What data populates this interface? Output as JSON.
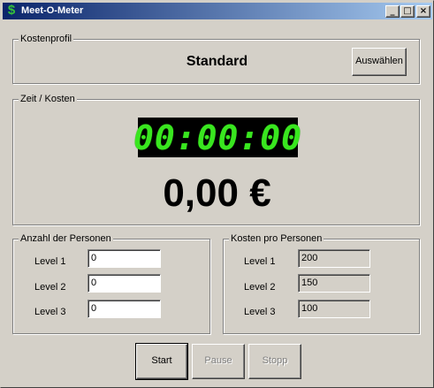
{
  "window": {
    "title": "Meet-O-Meter",
    "icon": "dollar-icon",
    "controls": {
      "minimize": "_",
      "maximize": "□",
      "close": "×"
    }
  },
  "profile": {
    "group_label": "Kostenprofil",
    "name": "Standard",
    "select_button": "Auswählen"
  },
  "time_cost": {
    "group_label": "Zeit / Kosten",
    "timer": "00:00:00",
    "cost": "0,00 €"
  },
  "persons": {
    "group_label": "Anzahl der Personen",
    "levels": [
      {
        "label": "Level 1",
        "value": "0"
      },
      {
        "label": "Level 2",
        "value": "0"
      },
      {
        "label": "Level 3",
        "value": "0"
      }
    ]
  },
  "cost_per_person": {
    "group_label": "Kosten pro Personen",
    "levels": [
      {
        "label": "Level 1",
        "value": "200"
      },
      {
        "label": "Level 2",
        "value": "150"
      },
      {
        "label": "Level 3",
        "value": "100"
      }
    ]
  },
  "actions": {
    "start": "Start",
    "pause": "Pause",
    "stop": "Stopp"
  },
  "colors": {
    "lcd_digits": "#39e61f",
    "title_gradient_start": "#0a246a",
    "title_gradient_end": "#a6caf0"
  }
}
